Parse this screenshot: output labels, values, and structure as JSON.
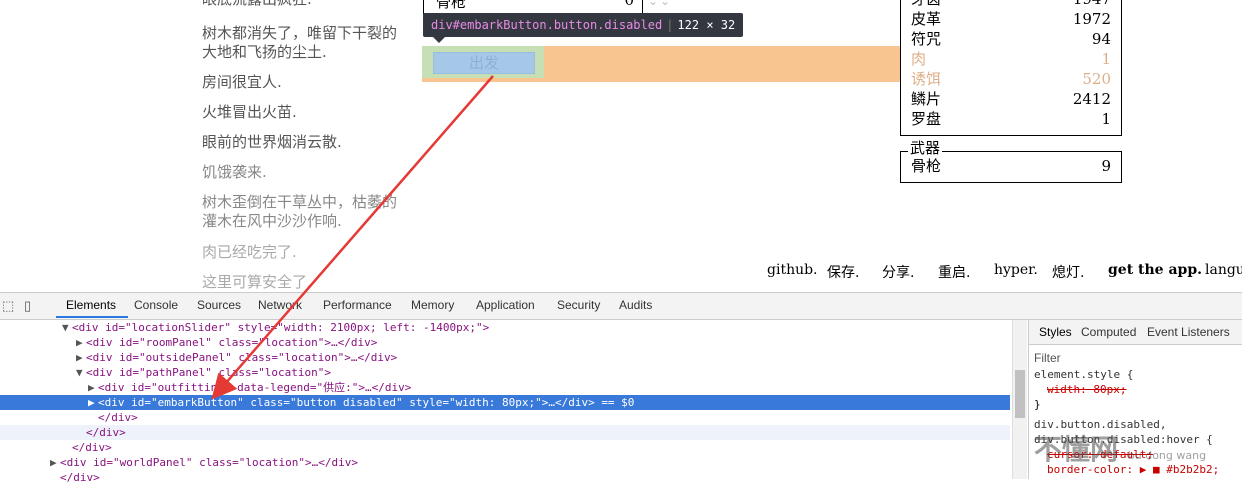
{
  "game": {
    "notifications": [
      "眼底流露出疯狂.",
      "树木都消失了，唯留下干裂的大地和飞扬的尘土.",
      "房间很宜人.",
      "火堆冒出火苗.",
      "眼前的世界烟消云散.",
      "饥饿袭来.",
      "树木歪倒在干草丛中，枯萎的灌木在风中沙沙作响.",
      "肉已经吃完了.",
      "这里可算安全了."
    ],
    "outfit_item": {
      "name": "骨枪",
      "value": "0"
    },
    "embark_button": {
      "label": "出发"
    },
    "tooltip": {
      "selector": "div#embarkButton.button.disabled",
      "size": "122 × 32"
    },
    "stores": [
      {
        "name": "牙齿",
        "qty": "1947"
      },
      {
        "name": "皮革",
        "qty": "1972"
      },
      {
        "name": "符咒",
        "qty": "94"
      },
      {
        "name": "肉",
        "qty": "1"
      },
      {
        "name": "诱饵",
        "qty": "520"
      },
      {
        "name": "鳞片",
        "qty": "2412"
      },
      {
        "name": "罗盘",
        "qty": "1"
      }
    ],
    "weapons": {
      "legend": "武器",
      "items": [
        {
          "name": "骨枪",
          "qty": "9"
        }
      ]
    },
    "menu": [
      "github.",
      "保存.",
      "分享.",
      "重启.",
      "hyper.",
      "熄灯.",
      "get the app.",
      "langua"
    ]
  },
  "devtools": {
    "tabs": [
      "Elements",
      "Console",
      "Sources",
      "Network",
      "Performance",
      "Memory",
      "Application",
      "Security",
      "Audits"
    ],
    "active_tab": "Elements",
    "dom_lines": [
      {
        "indent": 62,
        "tri": "▼",
        "html": "<div id=\"locationSlider\" style=\"width: 2100px; left: -1400px;\">"
      },
      {
        "indent": 76,
        "tri": "▶",
        "html": "<div id=\"roomPanel\" class=\"location\">…</div>"
      },
      {
        "indent": 76,
        "tri": "▶",
        "html": "<div id=\"outsidePanel\" class=\"location\">…</div>"
      },
      {
        "indent": 76,
        "tri": "▼",
        "html": "<div id=\"pathPanel\" class=\"location\">"
      },
      {
        "indent": 88,
        "tri": "▶",
        "html": "<div id=\"outfitting\" data-legend=\"供应:\">…</div>"
      },
      {
        "indent": 88,
        "tri": "▶",
        "html": "<div id=\"embarkButton\" class=\"button disabled\" style=\"width: 80px;\">…</div> == $0"
      },
      {
        "indent": 88,
        "tri": "",
        "html": "</div>"
      },
      {
        "indent": 76,
        "tri": "",
        "html": "</div>"
      },
      {
        "indent": 62,
        "tri": "",
        "html": "</div>"
      },
      {
        "indent": 50,
        "tri": "▶",
        "html": "<div id=\"worldPanel\" class=\"location\">…</div>"
      },
      {
        "indent": 50,
        "tri": "",
        "html": "</div>"
      }
    ],
    "styles_tabs": [
      "Styles",
      "Computed",
      "Event Listeners"
    ],
    "filter_placeholder": "Filter",
    "styles_lines": [
      "element.style {",
      "width: 80px;",
      "}",
      "div.button.disabled,",
      "div.button.disabled:hover {",
      "cursor: default;",
      "border-color: ▶ ■ #b2b2b2;"
    ]
  },
  "watermark": {
    "text": "不懂网",
    "sub": "bu dong wang"
  },
  "colors": {
    "selection": "#3879d9",
    "highlight": "#f6b26b",
    "tooltip_bg": "#333740",
    "arrow": "#e53935"
  }
}
